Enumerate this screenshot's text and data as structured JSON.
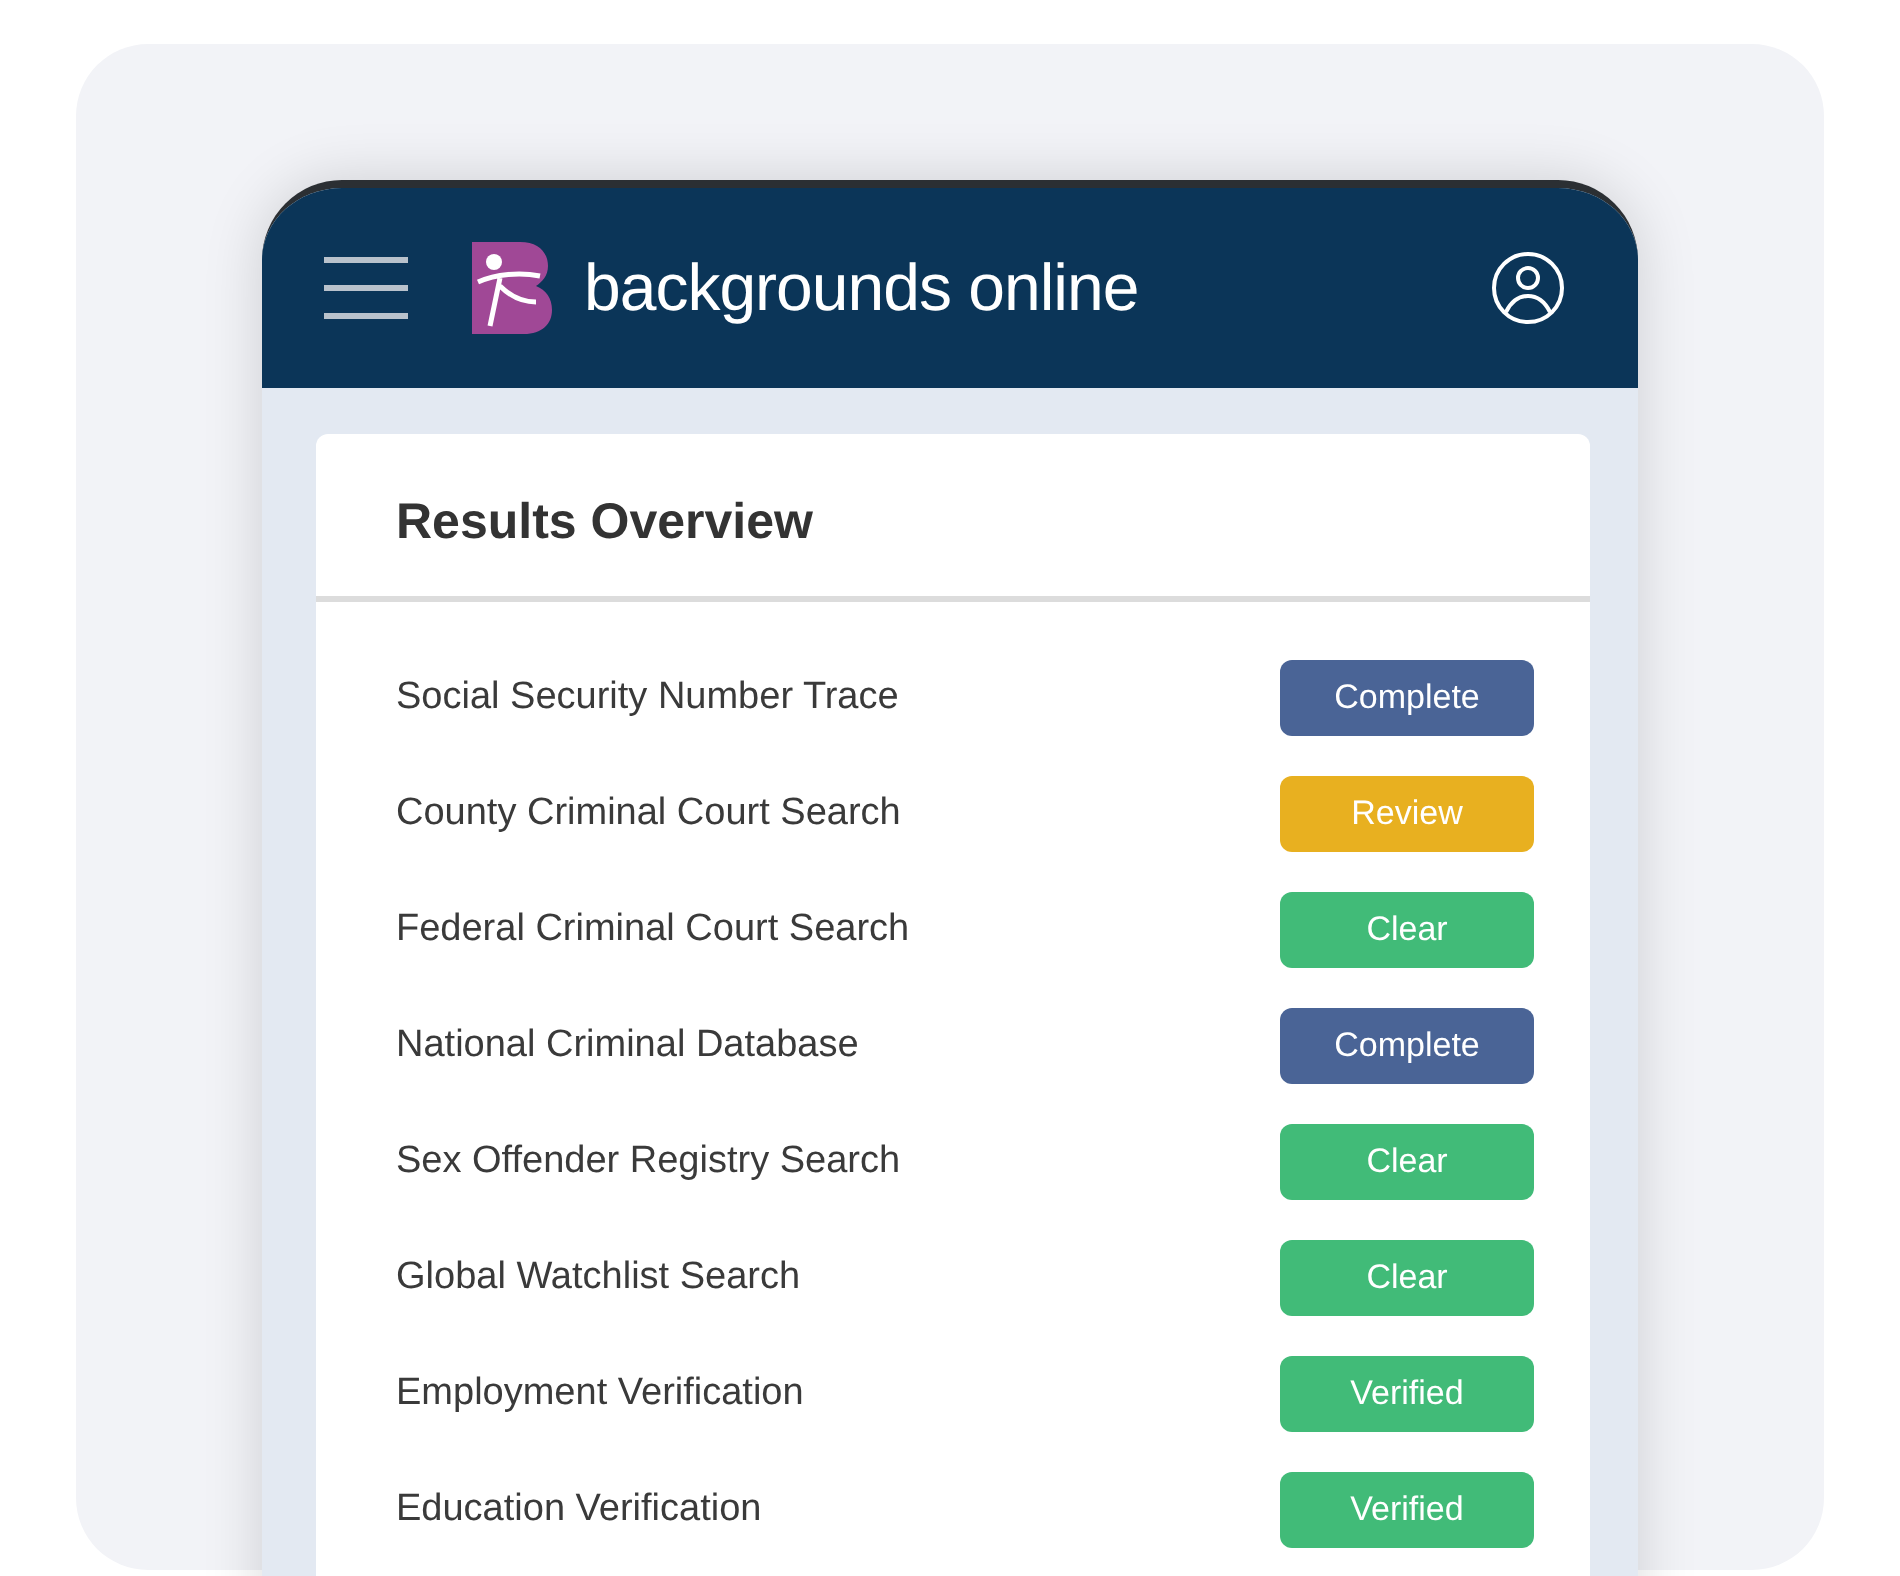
{
  "header": {
    "brand": "backgrounds online"
  },
  "card": {
    "title": "Results Overview",
    "rows": [
      {
        "label": "Social Security Number Trace",
        "status": "Complete",
        "color": "#4a6496"
      },
      {
        "label": "County Criminal Court Search",
        "status": "Review",
        "color": "#e8b020"
      },
      {
        "label": "Federal Criminal Court Search",
        "status": "Clear",
        "color": "#41bb78"
      },
      {
        "label": "National Criminal Database",
        "status": "Complete",
        "color": "#4a6496"
      },
      {
        "label": "Sex Offender Registry Search",
        "status": "Clear",
        "color": "#41bb78"
      },
      {
        "label": "Global Watchlist Search",
        "status": "Clear",
        "color": "#41bb78"
      },
      {
        "label": "Employment Verification",
        "status": "Verified",
        "color": "#41bb78"
      },
      {
        "label": "Education Verification",
        "status": "Verified",
        "color": "#41bb78"
      }
    ]
  }
}
